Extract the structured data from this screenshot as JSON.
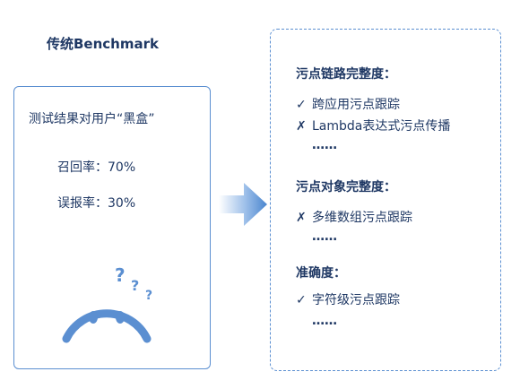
{
  "left": {
    "title": "传统Benchmark",
    "box_desc": "测试结果对用户“黑盒”",
    "recall": "召回率：70%",
    "false_positive": "误报率：30%"
  },
  "right": {
    "sections": [
      {
        "heading": "污点链路完整度：",
        "items": [
          {
            "mark": "✓",
            "text": "跨应用污点跟踪"
          },
          {
            "mark": "✗",
            "text": "Lambda表达式污点传播"
          }
        ],
        "ellipsis": "……"
      },
      {
        "heading": "污点对象完整度：",
        "items": [
          {
            "mark": "✗",
            "text": "多维数组污点跟踪"
          }
        ],
        "ellipsis": "……"
      },
      {
        "heading": "准确度：",
        "items": [
          {
            "mark": "✓",
            "text": "字符级污点跟踪"
          }
        ],
        "ellipsis": "……"
      }
    ]
  },
  "colors": {
    "accent": "#5b8fd1",
    "text": "#1f3864"
  },
  "icons": {
    "face": "confused-face-icon",
    "arrow": "right-arrow-icon"
  }
}
